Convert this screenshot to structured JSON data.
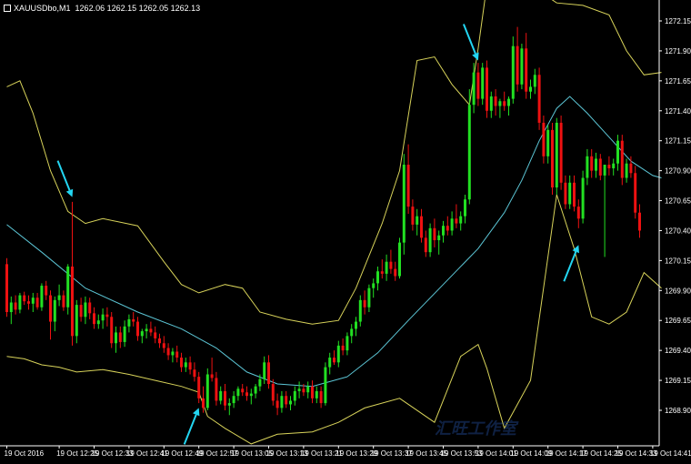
{
  "header": {
    "symbol_timeframe": "XAUUSDbo,M1",
    "ohlc": "1262.06 1262.15 1262.05 1262.13"
  },
  "watermark": {
    "text": "汇旺工作室"
  },
  "colors": {
    "background": "#000000",
    "bullish_candle": "#22e022",
    "bearish_candle": "#ee1111",
    "doji_candle": "#ffffff",
    "moving_average": "#5cc6d6",
    "bollinger_bands": "#d8d35a",
    "annotation_arrow": "#23d6f2",
    "axis_text": "#ffffff"
  },
  "chart_data": {
    "type": "candlestick",
    "y_axis": {
      "min": 1268.8,
      "max": 1272.25,
      "tick_labels": [
        "1272.15",
        "1271.90",
        "1271.65",
        "1271.40",
        "1271.15",
        "1270.90",
        "1270.65",
        "1270.40",
        "1270.15",
        "1269.90",
        "1269.65",
        "1269.40",
        "1269.15",
        "1268.90"
      ],
      "tick_values": [
        1272.15,
        1271.9,
        1271.65,
        1271.4,
        1271.15,
        1270.9,
        1270.65,
        1270.4,
        1270.15,
        1269.9,
        1269.65,
        1269.4,
        1269.15,
        1268.9
      ]
    },
    "x_axis": {
      "tick_labels": [
        "19 Oct 2016",
        "19 Oct 12:25",
        "19 Oct 12:33",
        "19 Oct 12:41",
        "19 Oct 12:49",
        "19 Oct 12:57",
        "19 Oct 13:05",
        "19 Oct 13:13",
        "19 Oct 13:21",
        "19 Oct 13:29",
        "19 Oct 13:37",
        "19 Oct 13:45",
        "19 Oct 13:53",
        "19 Oct 14:01",
        "19 Oct 14:09",
        "19 Oct 14:17",
        "19 Oct 14:25",
        "19 Oct 14:33",
        "19 Oct 14:41"
      ],
      "tick_bar_index": [
        0,
        12,
        20,
        28,
        36,
        44,
        52,
        60,
        68,
        76,
        84,
        92,
        100,
        108,
        116,
        124,
        132,
        140,
        148
      ]
    },
    "candles": [
      [
        1270.12,
        1270.17,
        1269.68,
        1269.72
      ],
      [
        1269.72,
        1269.85,
        1269.62,
        1269.8
      ],
      [
        1269.8,
        1269.86,
        1269.7,
        1269.74
      ],
      [
        1269.74,
        1269.88,
        1269.71,
        1269.86
      ],
      [
        1269.86,
        1269.89,
        1269.78,
        1269.81
      ],
      [
        1269.81,
        1269.86,
        1269.74,
        1269.79
      ],
      [
        1269.79,
        1269.88,
        1269.72,
        1269.84
      ],
      [
        1269.84,
        1269.88,
        1269.74,
        1269.76
      ],
      [
        1269.76,
        1269.96,
        1269.73,
        1269.94
      ],
      [
        1269.94,
        1269.98,
        1269.82,
        1269.86
      ],
      [
        1269.86,
        1269.9,
        1269.49,
        1269.64
      ],
      [
        1269.64,
        1269.85,
        1269.56,
        1269.82
      ],
      [
        1269.82,
        1269.95,
        1269.77,
        1269.86
      ],
      [
        1269.86,
        1269.9,
        1269.73,
        1269.76
      ],
      [
        1269.76,
        1270.12,
        1269.7,
        1270.1
      ],
      [
        1270.1,
        1270.64,
        1269.44,
        1269.52
      ],
      [
        1269.52,
        1269.82,
        1269.46,
        1269.78
      ],
      [
        1269.78,
        1269.84,
        1269.64,
        1269.68
      ],
      [
        1269.68,
        1269.85,
        1269.62,
        1269.8
      ],
      [
        1269.8,
        1269.84,
        1269.66,
        1269.71
      ],
      [
        1269.71,
        1269.76,
        1269.58,
        1269.62
      ],
      [
        1269.62,
        1269.7,
        1269.58,
        1269.65
      ],
      [
        1269.65,
        1269.75,
        1269.58,
        1269.7
      ],
      [
        1269.7,
        1269.76,
        1269.6,
        1269.68
      ],
      [
        1269.68,
        1269.72,
        1269.42,
        1269.46
      ],
      [
        1269.46,
        1269.6,
        1269.38,
        1269.55
      ],
      [
        1269.55,
        1269.6,
        1269.42,
        1269.47
      ],
      [
        1269.47,
        1269.65,
        1269.43,
        1269.6
      ],
      [
        1269.6,
        1269.7,
        1269.55,
        1269.66
      ],
      [
        1269.66,
        1269.72,
        1269.6,
        1269.64
      ],
      [
        1269.64,
        1269.68,
        1269.48,
        1269.52
      ],
      [
        1269.52,
        1269.58,
        1269.46,
        1269.56
      ],
      [
        1269.56,
        1269.62,
        1269.5,
        1269.58
      ],
      [
        1269.58,
        1269.64,
        1269.52,
        1269.55
      ],
      [
        1269.55,
        1269.6,
        1269.46,
        1269.5
      ],
      [
        1269.5,
        1269.54,
        1269.42,
        1269.46
      ],
      [
        1269.46,
        1269.52,
        1269.38,
        1269.42
      ],
      [
        1269.42,
        1269.46,
        1269.32,
        1269.36
      ],
      [
        1269.36,
        1269.42,
        1269.3,
        1269.39
      ],
      [
        1269.39,
        1269.44,
        1269.3,
        1269.34
      ],
      [
        1269.34,
        1269.38,
        1269.22,
        1269.26
      ],
      [
        1269.26,
        1269.34,
        1269.22,
        1269.3
      ],
      [
        1269.3,
        1269.35,
        1269.2,
        1269.24
      ],
      [
        1269.24,
        1269.3,
        1269.14,
        1269.18
      ],
      [
        1269.18,
        1269.22,
        1268.96,
        1269.0
      ],
      [
        1269.0,
        1269.1,
        1268.88,
        1268.92
      ],
      [
        1268.92,
        1269.25,
        1268.9,
        1269.2
      ],
      [
        1269.2,
        1269.34,
        1269.14,
        1269.17
      ],
      [
        1269.17,
        1269.22,
        1268.94,
        1268.98
      ],
      [
        1268.98,
        1269.1,
        1268.95,
        1269.06
      ],
      [
        1269.06,
        1269.12,
        1268.9,
        1268.94
      ],
      [
        1268.94,
        1269.0,
        1268.86,
        1268.96
      ],
      [
        1268.96,
        1269.06,
        1268.92,
        1269.02
      ],
      [
        1269.02,
        1269.1,
        1268.98,
        1269.08
      ],
      [
        1269.08,
        1269.12,
        1269.02,
        1269.05
      ],
      [
        1269.05,
        1269.1,
        1268.98,
        1269.02
      ],
      [
        1269.02,
        1269.08,
        1268.95,
        1269.04
      ],
      [
        1269.04,
        1269.12,
        1269.0,
        1269.1
      ],
      [
        1269.1,
        1269.2,
        1269.06,
        1269.16
      ],
      [
        1269.16,
        1269.35,
        1269.12,
        1269.3
      ],
      [
        1269.3,
        1269.36,
        1269.08,
        1269.12
      ],
      [
        1269.12,
        1269.16,
        1268.94,
        1268.98
      ],
      [
        1268.98,
        1269.04,
        1268.86,
        1268.92
      ],
      [
        1268.92,
        1269.06,
        1268.88,
        1269.02
      ],
      [
        1269.02,
        1269.06,
        1268.92,
        1268.95
      ],
      [
        1268.95,
        1269.02,
        1268.9,
        1268.98
      ],
      [
        1268.98,
        1269.1,
        1268.94,
        1269.06
      ],
      [
        1269.06,
        1269.14,
        1269.0,
        1269.08
      ],
      [
        1269.08,
        1269.12,
        1269.02,
        1269.05
      ],
      [
        1269.05,
        1269.14,
        1269.0,
        1269.1
      ],
      [
        1269.1,
        1269.15,
        1268.96,
        1269.0
      ],
      [
        1269.0,
        1269.1,
        1268.96,
        1269.06
      ],
      [
        1269.06,
        1269.1,
        1268.92,
        1268.96
      ],
      [
        1268.96,
        1269.3,
        1268.94,
        1269.26
      ],
      [
        1269.26,
        1269.38,
        1269.2,
        1269.34
      ],
      [
        1269.34,
        1269.4,
        1269.28,
        1269.3
      ],
      [
        1269.3,
        1269.48,
        1269.26,
        1269.44
      ],
      [
        1269.44,
        1269.5,
        1269.36,
        1269.4
      ],
      [
        1269.4,
        1269.55,
        1269.36,
        1269.52
      ],
      [
        1269.52,
        1269.62,
        1269.46,
        1269.58
      ],
      [
        1269.58,
        1269.68,
        1269.52,
        1269.64
      ],
      [
        1269.64,
        1269.86,
        1269.6,
        1269.82
      ],
      [
        1269.82,
        1269.9,
        1269.7,
        1269.76
      ],
      [
        1269.76,
        1269.95,
        1269.72,
        1269.92
      ],
      [
        1269.92,
        1270.0,
        1269.84,
        1269.96
      ],
      [
        1269.96,
        1270.1,
        1269.9,
        1270.06
      ],
      [
        1270.06,
        1270.16,
        1270.0,
        1270.04
      ],
      [
        1270.04,
        1270.2,
        1269.98,
        1270.14
      ],
      [
        1270.14,
        1270.24,
        1270.04,
        1270.08
      ],
      [
        1270.08,
        1270.14,
        1269.98,
        1270.02
      ],
      [
        1270.02,
        1270.34,
        1270.0,
        1270.3
      ],
      [
        1270.3,
        1271.04,
        1270.2,
        1270.95
      ],
      [
        1270.95,
        1271.12,
        1270.54,
        1270.6
      ],
      [
        1270.6,
        1270.66,
        1270.4,
        1270.45
      ],
      [
        1270.45,
        1270.58,
        1270.36,
        1270.52
      ],
      [
        1270.52,
        1270.58,
        1270.3,
        1270.34
      ],
      [
        1270.34,
        1270.4,
        1270.18,
        1270.22
      ],
      [
        1270.22,
        1270.46,
        1270.18,
        1270.42
      ],
      [
        1270.42,
        1270.5,
        1270.26,
        1270.32
      ],
      [
        1270.32,
        1270.4,
        1270.2,
        1270.36
      ],
      [
        1270.36,
        1270.48,
        1270.3,
        1270.44
      ],
      [
        1270.44,
        1270.52,
        1270.36,
        1270.4
      ],
      [
        1270.4,
        1270.56,
        1270.36,
        1270.5
      ],
      [
        1270.5,
        1270.62,
        1270.42,
        1270.46
      ],
      [
        1270.46,
        1270.56,
        1270.4,
        1270.52
      ],
      [
        1270.52,
        1270.7,
        1270.46,
        1270.66
      ],
      [
        1270.66,
        1271.58,
        1270.62,
        1271.45
      ],
      [
        1271.45,
        1271.8,
        1271.38,
        1271.72
      ],
      [
        1271.72,
        1271.8,
        1271.44,
        1271.5
      ],
      [
        1271.5,
        1271.8,
        1271.45,
        1271.76
      ],
      [
        1271.76,
        1271.82,
        1271.34,
        1271.4
      ],
      [
        1271.4,
        1271.56,
        1271.34,
        1271.52
      ],
      [
        1271.52,
        1271.58,
        1271.36,
        1271.44
      ],
      [
        1271.44,
        1271.5,
        1271.34,
        1271.48
      ],
      [
        1271.48,
        1271.56,
        1271.4,
        1271.44
      ],
      [
        1271.44,
        1271.52,
        1271.36,
        1271.5
      ],
      [
        1271.5,
        1272.02,
        1271.46,
        1271.94
      ],
      [
        1271.94,
        1272.1,
        1271.56,
        1271.62
      ],
      [
        1271.62,
        1271.96,
        1271.58,
        1271.92
      ],
      [
        1271.92,
        1272.05,
        1271.5,
        1271.56
      ],
      [
        1271.56,
        1271.66,
        1271.5,
        1271.6
      ],
      [
        1271.6,
        1271.75,
        1271.54,
        1271.7
      ],
      [
        1271.7,
        1271.76,
        1271.24,
        1271.3
      ],
      [
        1271.3,
        1271.36,
        1270.96,
        1271.02
      ],
      [
        1271.02,
        1271.28,
        1270.96,
        1271.24
      ],
      [
        1271.24,
        1271.3,
        1270.7,
        1270.76
      ],
      [
        1270.76,
        1271.34,
        1270.7,
        1271.3
      ],
      [
        1271.3,
        1271.36,
        1270.74,
        1270.8
      ],
      [
        1270.8,
        1270.86,
        1270.58,
        1270.62
      ],
      [
        1270.62,
        1270.86,
        1270.58,
        1270.8
      ],
      [
        1270.8,
        1270.86,
        1270.56,
        1270.6
      ],
      [
        1270.6,
        1270.66,
        1270.42,
        1270.5
      ],
      [
        1270.5,
        1270.9,
        1270.46,
        1270.84
      ],
      [
        1270.84,
        1271.08,
        1270.78,
        1271.02
      ],
      [
        1271.02,
        1271.08,
        1270.84,
        1270.9
      ],
      [
        1270.9,
        1271.05,
        1270.84,
        1271.0
      ],
      [
        1271.0,
        1271.04,
        1270.82,
        1270.86
      ],
      [
        1270.86,
        1270.9,
        1270.18,
        1270.95
      ],
      [
        1270.95,
        1271.02,
        1270.86,
        1270.92
      ],
      [
        1270.92,
        1271.0,
        1270.86,
        1270.96
      ],
      [
        1270.96,
        1271.2,
        1270.9,
        1271.15
      ],
      [
        1271.15,
        1271.2,
        1270.78,
        1270.84
      ],
      [
        1270.84,
        1271.0,
        1270.8,
        1270.96
      ],
      [
        1270.96,
        1271.02,
        1270.84,
        1270.88
      ],
      [
        1270.88,
        1270.94,
        1270.5,
        1270.55
      ],
      [
        1270.55,
        1270.62,
        1270.34,
        1270.4
      ]
    ],
    "moving_average": [
      [
        0,
        1270.45
      ],
      [
        8,
        1270.22
      ],
      [
        18,
        1269.92
      ],
      [
        30,
        1269.72
      ],
      [
        40,
        1269.58
      ],
      [
        48,
        1269.42
      ],
      [
        55,
        1269.22
      ],
      [
        62,
        1269.12
      ],
      [
        70,
        1269.1
      ],
      [
        78,
        1269.18
      ],
      [
        85,
        1269.38
      ],
      [
        92,
        1269.65
      ],
      [
        100,
        1269.95
      ],
      [
        108,
        1270.25
      ],
      [
        114,
        1270.55
      ],
      [
        118,
        1270.82
      ],
      [
        122,
        1271.15
      ],
      [
        126,
        1271.42
      ],
      [
        129,
        1271.52
      ],
      [
        133,
        1271.38
      ],
      [
        138,
        1271.18
      ],
      [
        143,
        1270.98
      ],
      [
        148,
        1270.86
      ],
      [
        150,
        1270.84
      ]
    ],
    "bollinger_upper": [
      [
        0,
        1271.6
      ],
      [
        3,
        1271.65
      ],
      [
        6,
        1271.38
      ],
      [
        10,
        1270.9
      ],
      [
        14,
        1270.56
      ],
      [
        18,
        1270.46
      ],
      [
        22,
        1270.5
      ],
      [
        30,
        1270.44
      ],
      [
        36,
        1270.14
      ],
      [
        40,
        1269.95
      ],
      [
        44,
        1269.88
      ],
      [
        50,
        1269.95
      ],
      [
        54,
        1269.92
      ],
      [
        58,
        1269.72
      ],
      [
        64,
        1269.66
      ],
      [
        70,
        1269.62
      ],
      [
        76,
        1269.65
      ],
      [
        80,
        1269.92
      ],
      [
        86,
        1270.46
      ],
      [
        90,
        1270.9
      ],
      [
        94,
        1271.82
      ],
      [
        98,
        1271.85
      ],
      [
        102,
        1271.62
      ],
      [
        106,
        1271.45
      ],
      [
        108,
        1271.92
      ],
      [
        110,
        1272.45
      ],
      [
        115,
        1272.5
      ],
      [
        120,
        1272.45
      ],
      [
        126,
        1272.3
      ],
      [
        132,
        1272.28
      ],
      [
        138,
        1272.2
      ],
      [
        142,
        1271.9
      ],
      [
        146,
        1271.7
      ],
      [
        150,
        1271.72
      ]
    ],
    "bollinger_lower": [
      [
        0,
        1269.35
      ],
      [
        4,
        1269.33
      ],
      [
        8,
        1269.28
      ],
      [
        12,
        1269.26
      ],
      [
        16,
        1269.22
      ],
      [
        22,
        1269.24
      ],
      [
        28,
        1269.2
      ],
      [
        34,
        1269.15
      ],
      [
        40,
        1269.1
      ],
      [
        44,
        1269.05
      ],
      [
        46,
        1268.85
      ],
      [
        50,
        1268.75
      ],
      [
        56,
        1268.62
      ],
      [
        62,
        1268.7
      ],
      [
        70,
        1268.72
      ],
      [
        76,
        1268.8
      ],
      [
        82,
        1268.92
      ],
      [
        90,
        1269.0
      ],
      [
        98,
        1268.8
      ],
      [
        104,
        1269.35
      ],
      [
        108,
        1269.45
      ],
      [
        110,
        1269.25
      ],
      [
        114,
        1268.75
      ],
      [
        120,
        1269.15
      ],
      [
        126,
        1270.7
      ],
      [
        130,
        1270.25
      ],
      [
        134,
        1269.68
      ],
      [
        138,
        1269.62
      ],
      [
        142,
        1269.72
      ],
      [
        146,
        1270.05
      ],
      [
        150,
        1269.92
      ]
    ],
    "annotation_arrows": [
      {
        "target_bar": 15,
        "target_price": 1270.68,
        "direction": "from-upper-left"
      },
      {
        "target_bar": 44,
        "target_price": 1268.92,
        "direction": "from-lower-left"
      },
      {
        "target_bar": 108,
        "target_price": 1271.82,
        "direction": "from-upper-left"
      },
      {
        "target_bar": 131,
        "target_price": 1270.28,
        "direction": "from-lower-left"
      }
    ]
  }
}
